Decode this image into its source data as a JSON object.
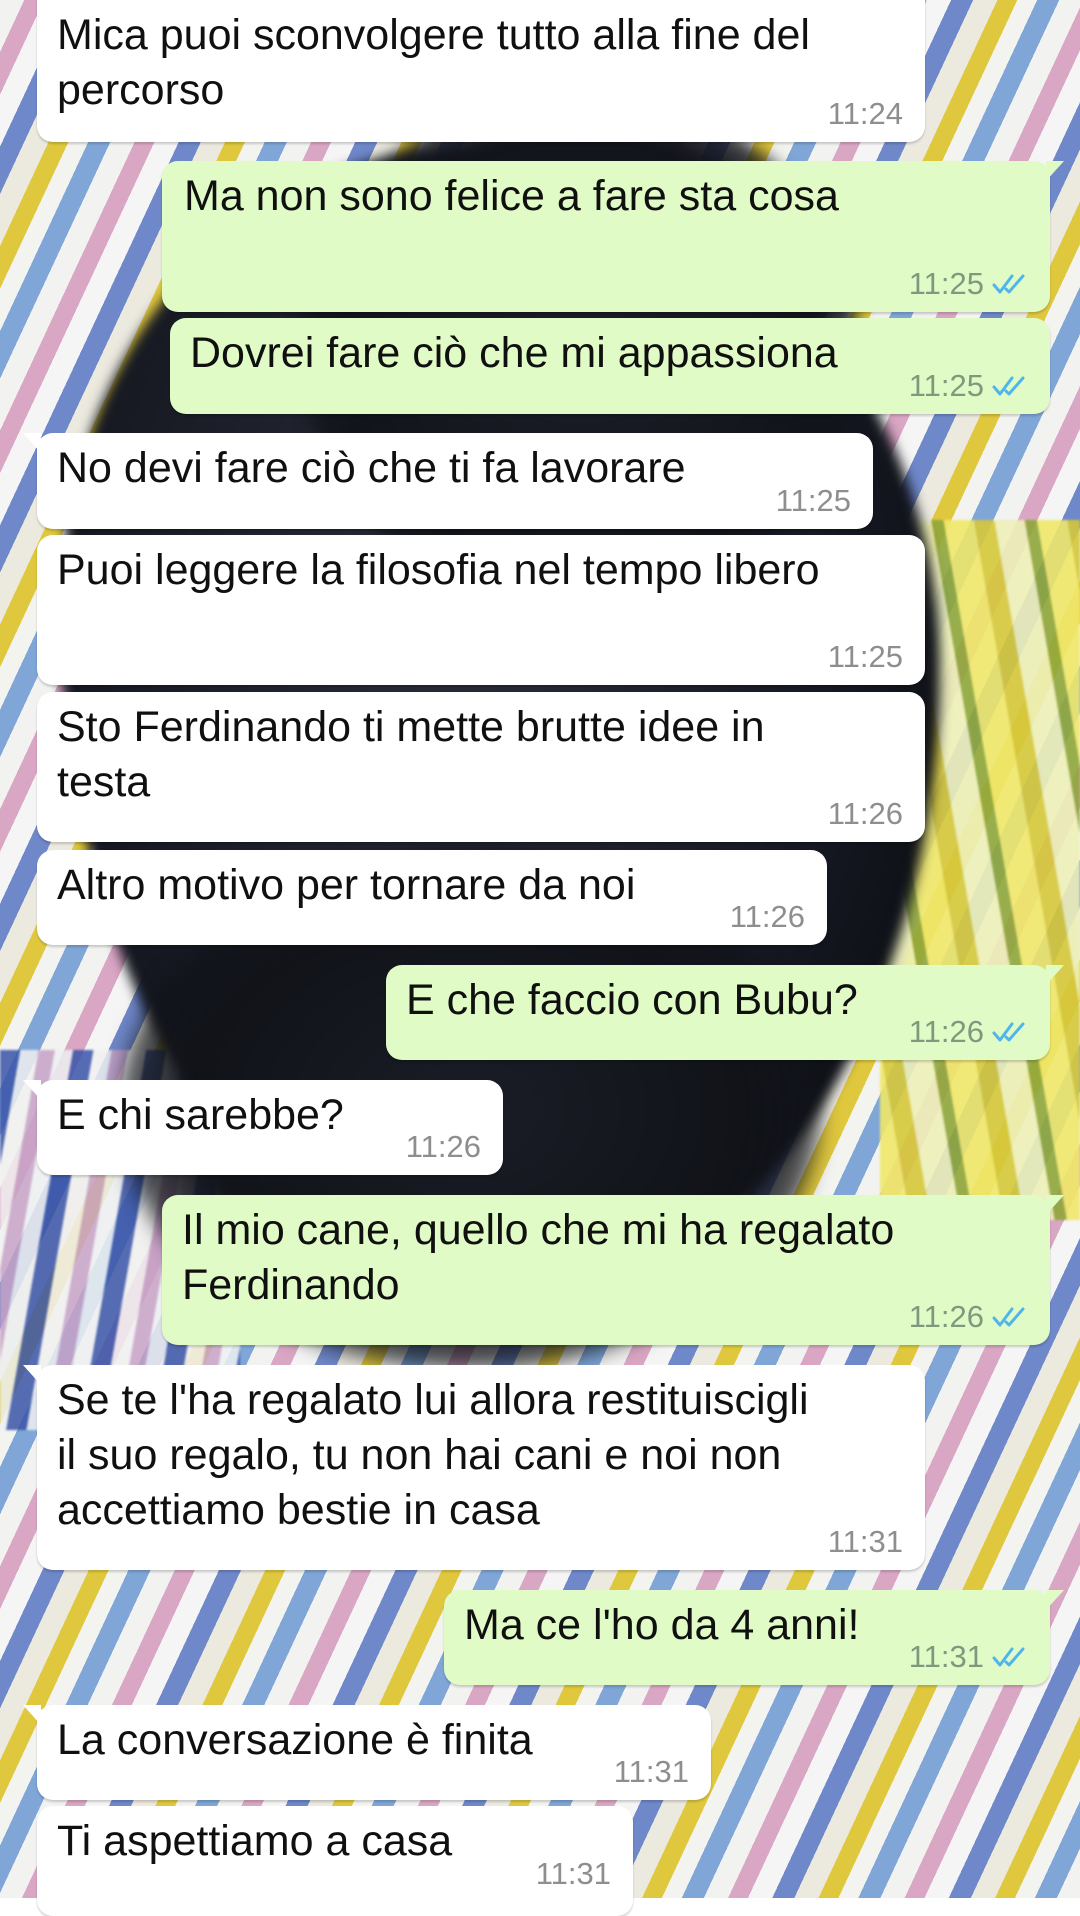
{
  "colors": {
    "incoming_bubble": "#ffffff",
    "outgoing_bubble": "#e1fbc6",
    "read_ticks": "#4fb6ec",
    "time_text": "#8e8e8e"
  },
  "messages": [
    {
      "text": "Mica puoi sconvolgere tutto alla fine del\npercorso",
      "time": "11:24",
      "direction": "in"
    },
    {
      "text": "Ma non sono felice a fare sta cosa",
      "time": "11:25",
      "direction": "out",
      "read": true
    },
    {
      "text": "Dovrei fare ciò che mi appassiona",
      "time": "11:25",
      "direction": "out",
      "read": true
    },
    {
      "text": "No devi fare ciò che ti fa lavorare",
      "time": "11:25",
      "direction": "in"
    },
    {
      "text": "Puoi leggere la filosofia nel tempo libero",
      "time": "11:25",
      "direction": "in"
    },
    {
      "text": "Sto Ferdinando ti mette brutte idee in\ntesta",
      "time": "11:26",
      "direction": "in"
    },
    {
      "text": "Altro motivo per tornare da noi",
      "time": "11:26",
      "direction": "in"
    },
    {
      "text": "E che faccio con Bubu?",
      "time": "11:26",
      "direction": "out",
      "read": true
    },
    {
      "text": "E chi sarebbe?",
      "time": "11:26",
      "direction": "in"
    },
    {
      "text": "Il mio cane, quello che mi ha regalato\nFerdinando",
      "time": "11:26",
      "direction": "out",
      "read": true
    },
    {
      "text": "Se te l'ha regalato lui allora restituiscigli\nil suo regalo, tu non hai cani e noi non\naccettiamo bestie in casa",
      "time": "11:31",
      "direction": "in"
    },
    {
      "text": "Ma ce l'ho da 4 anni!",
      "time": "11:31",
      "direction": "out",
      "read": true
    },
    {
      "text": "La conversazione è finita",
      "time": "11:31",
      "direction": "in"
    },
    {
      "text": "Ti aspettiamo a casa",
      "time": "11:31",
      "direction": "in"
    }
  ]
}
